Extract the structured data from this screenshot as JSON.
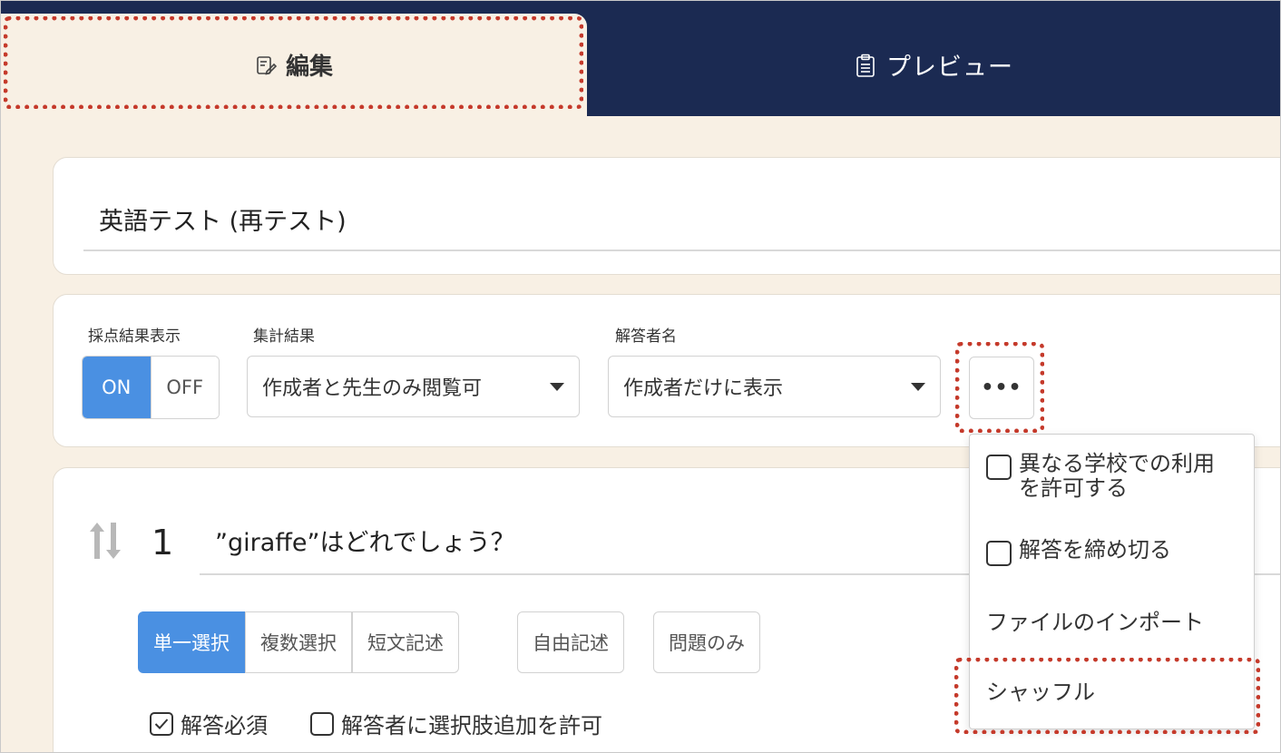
{
  "tabs": {
    "edit_label": "編集",
    "preview_label": "プレビュー"
  },
  "form": {
    "title": "英語テスト (再テスト)"
  },
  "settings": {
    "grading_label": "採点結果表示",
    "toggle_on": "ON",
    "toggle_off": "OFF",
    "summary_label": "集計結果",
    "summary_value": "作成者と先生のみ閲覧可",
    "respondent_label": "解答者名",
    "respondent_value": "作成者だけに表示",
    "more_label": "•••"
  },
  "menu": {
    "item1_line1": "異なる学校での利用",
    "item1_line2": "を許可する",
    "item2": "解答を締め切る",
    "item3": "ファイルのインポート",
    "item4": "シャッフル"
  },
  "question": {
    "number": "1",
    "text": "”giraffe”はどれでしょう？",
    "types": [
      "単一選択",
      "複数選択",
      "短文記述",
      "自由記述",
      "問題のみ"
    ],
    "required_label": "解答必須",
    "allow_add_label": "解答者に選択肢追加を許可"
  },
  "colors": {
    "nav": "#1b2a52",
    "accent": "#4a90e2",
    "background": "#f8f0e4",
    "highlight": "#c53a2b"
  }
}
